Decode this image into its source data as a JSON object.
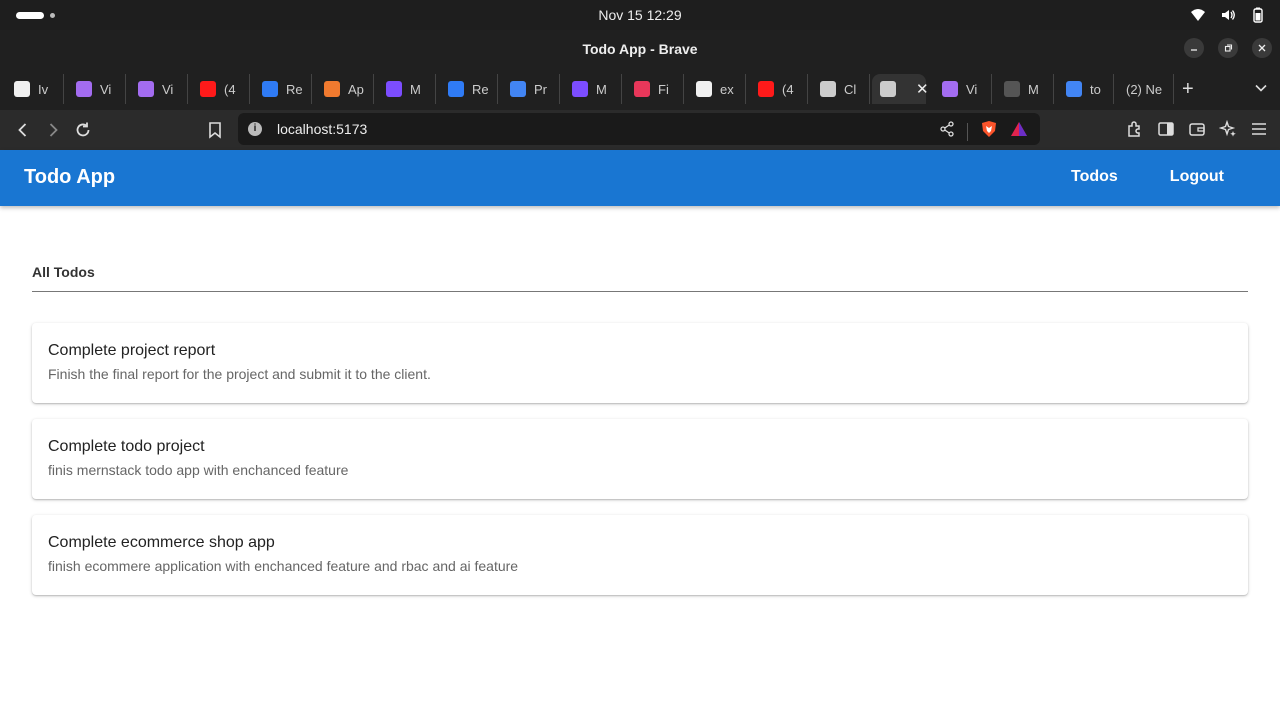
{
  "os": {
    "clock": "Nov 15  12:29"
  },
  "window": {
    "title": "Todo App - Brave"
  },
  "tabs": [
    {
      "title": "Iv",
      "color": "#f0f0f0"
    },
    {
      "title": "Vi",
      "color": "#a36cf0"
    },
    {
      "title": "Vi",
      "color": "#a36cf0"
    },
    {
      "title": "(4",
      "color": "#ff1a1a"
    },
    {
      "title": "Re",
      "color": "#2f7bf5"
    },
    {
      "title": "Ap",
      "color": "#f07a2f"
    },
    {
      "title": "M",
      "color": "#7c4dff"
    },
    {
      "title": "Re",
      "color": "#2f7bf5"
    },
    {
      "title": "Pr",
      "color": "#4285f4"
    },
    {
      "title": "M",
      "color": "#7c4dff"
    },
    {
      "title": "Fi",
      "color": "#e8375a"
    },
    {
      "title": "ex",
      "color": "#f0f0f0"
    },
    {
      "title": "(4",
      "color": "#ff1a1a"
    },
    {
      "title": "Cl",
      "color": "#cccccc"
    },
    {
      "title": "",
      "color": "#cccccc",
      "active": true
    },
    {
      "title": "Vi",
      "color": "#a36cf0"
    },
    {
      "title": "M",
      "color": "#555555"
    },
    {
      "title": "to",
      "color": "#4285f4"
    },
    {
      "title": "(2) Ne",
      "color": "#202020"
    }
  ],
  "toolbar": {
    "url": "localhost:5173"
  },
  "app": {
    "title": "Todo App",
    "nav": {
      "todos": "Todos",
      "logout": "Logout"
    },
    "brand_color": "#1976d2"
  },
  "section": {
    "title": "All Todos"
  },
  "todos": [
    {
      "title": "Complete project report",
      "description": "Finish the final report for the project and submit it to the client."
    },
    {
      "title": "Complete todo project",
      "description": "finis mernstack todo app with enchanced feature"
    },
    {
      "title": "Complete ecommerce shop app",
      "description": "finish ecommere application with enchanced feature and rbac and ai feature"
    }
  ]
}
